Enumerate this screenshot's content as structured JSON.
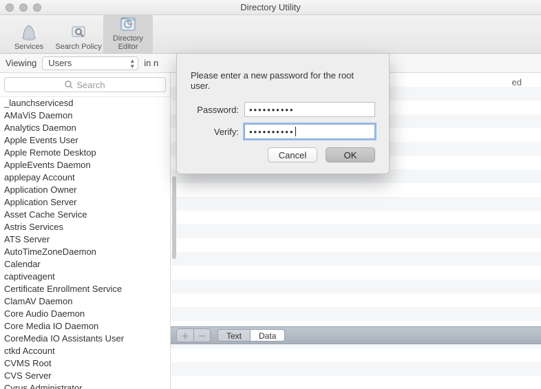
{
  "window": {
    "title": "Directory Utility"
  },
  "toolbar": {
    "items": [
      {
        "label": "Services"
      },
      {
        "label": "Search Policy"
      },
      {
        "label": "Directory Editor"
      }
    ],
    "active_index": 2
  },
  "viewbar": {
    "viewing_label": "Viewing",
    "select_value": "Users",
    "in_label": "in n",
    "partial_right": "ed"
  },
  "search": {
    "placeholder": "Search"
  },
  "users": [
    "_launchservicesd",
    "AMaViS Daemon",
    "Analytics Daemon",
    "Apple Events User",
    "Apple Remote Desktop",
    "AppleEvents Daemon",
    "applepay Account",
    "Application Owner",
    "Application Server",
    "Asset Cache Service",
    "Astris Services",
    "ATS Server",
    "AutoTimeZoneDaemon",
    "Calendar",
    "captiveagent",
    "Certificate Enrollment Service",
    "ClamAV Daemon",
    "Core Audio Daemon",
    "Core Media IO Daemon",
    "CoreMedia IO Assistants User",
    "ctkd Account",
    "CVMS Root",
    "CVS Server",
    "Cyrus Administrator"
  ],
  "editbar": {
    "seg": {
      "text": "Text",
      "data": "Data",
      "selected": "data"
    }
  },
  "sheet": {
    "message": "Please enter a new password for the root user.",
    "password_label": "Password:",
    "verify_label": "Verify:",
    "password_value": "••••••••••",
    "verify_value": "••••••••••",
    "cancel": "Cancel",
    "ok": "OK"
  }
}
